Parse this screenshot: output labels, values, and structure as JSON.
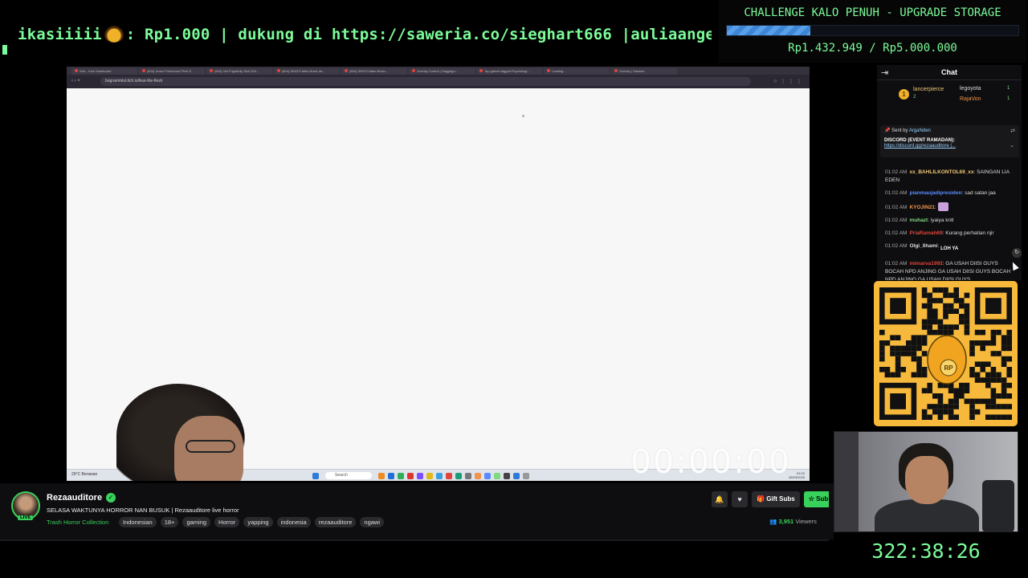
{
  "ticker": {
    "prefix": "ikasiiiii",
    "mid": ": Rp1.000 |  dukung di https://saweria.co/sieghart666 |auliaange"
  },
  "challenge": {
    "title": "CHALLENGE KALO PENUH - UPGRADE STORAGE",
    "amount": "Rp1.432.949 / Rp5.000.000",
    "progress_fraction": 0.287,
    "bar_color": "#3c86d6"
  },
  "browser": {
    "tabs": [
      "Kick - Kick Dashboard",
      "(604) Unser Freesound Pixel S..",
      "(604) Get Frightfully Sick 200...",
      "(604) DEATH talks Music da...",
      "(604) DEATH talks Music...",
      "Overlay Control | Saggsign...",
      "Top games tagged Psychologi...",
      "Loading...",
      "Overlay | Saweria"
    ],
    "url": "bogrammist.itch.io/fear-the-flesh",
    "weather": "29°C Berawan",
    "search_label": "Search",
    "clock_time": "01:02",
    "clock_date": "26/03/2026"
  },
  "stream_timer": "00:00:00",
  "chat": {
    "title": "Chat",
    "leaders": [
      {
        "name": "lancerpierce",
        "count": "2",
        "color": "#f0c674"
      },
      {
        "name": "legoyota",
        "count": "1",
        "color": "#dddddd"
      },
      {
        "name": "RajaVon",
        "count": "1",
        "color": "#f0954a"
      }
    ],
    "pinned": {
      "sent_by_label": "Sent by",
      "sent_by_user": "ArgaNden",
      "label": "DISCORD (EVENT RAMADAN):",
      "link": "https://discord.gg/rezaauditore |..."
    },
    "messages": [
      {
        "time": "01:02 AM",
        "user": "xx_BAHLILKONTOL69_xx",
        "color": "#f0c674",
        "text": ": SAINGAN LIA EDEN"
      },
      {
        "time": "01:02 AM",
        "user": "pianmaujadipresiden",
        "color": "#5a8cff",
        "text": ": sad satan jaa"
      },
      {
        "time": "01:02 AM",
        "user": "KYOJIN21",
        "color": "#f0954a",
        "text": ":"
      },
      {
        "time": "01:02 AM",
        "user": "muhazt",
        "color": "#7fd97f",
        "text": ": iyaiya kntl"
      },
      {
        "time": "01:02 AM",
        "user": "PriaRamah69",
        "color": "#e0443b",
        "text": ": Kurang perhatian njir"
      },
      {
        "time": "01:02 AM",
        "user": "Olgi_Ilhami",
        "color": "#dddddd",
        "text": ":"
      },
      {
        "time": "01:02 AM",
        "user": "mimarva1993",
        "color": "#e0443b",
        "text": ": GA USAH DIISI GUYS BOCAH NPD ANJING GA USAH DIISI GUYS BOCAH NPD ANJING GA USAH DIISI GUYS"
      }
    ],
    "emote_text": "LOH YA"
  },
  "qr": {
    "badge": "RP",
    "bg_color": "#f6b93b"
  },
  "streamer": {
    "name": "Rezaauditore",
    "live_label": "LIVE",
    "title": "SELASA WAKTUNYA HORROR NAN BUSUK | Rezaauditore live horror",
    "category": "Trash Horror Collection",
    "tags": [
      "Indonesian",
      "18+",
      "gaming",
      "Horror",
      "yapping",
      "indonesia",
      "rezaauditore",
      "ngawi"
    ],
    "gift_label": "Gift Subs",
    "sub_label": "Sub",
    "viewers_count": "3,951",
    "viewers_label": "Viewers",
    "accent": "#38d15b"
  },
  "subathon_timer": "322:38:26"
}
